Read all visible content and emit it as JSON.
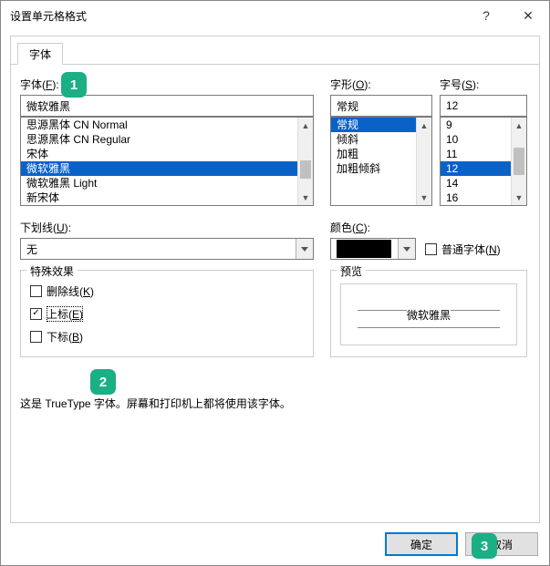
{
  "window": {
    "title": "设置单元格格式"
  },
  "tabs": {
    "font": "字体"
  },
  "labels": {
    "font": "字体(",
    "font_key": "F",
    "font_suffix": "):",
    "style": "字形(",
    "style_key": "O",
    "style_suffix": "):",
    "size": "字号(",
    "size_key": "S",
    "size_suffix": "):",
    "underline": "下划线(",
    "underline_key": "U",
    "underline_suffix": "):",
    "color": "颜色(",
    "color_key": "C",
    "color_suffix": "):",
    "effects": "特殊效果",
    "preview": "预览",
    "strike": "删除线(",
    "strike_key": "K",
    "strike_suffix": ")",
    "super": "上标(",
    "super_key": "E",
    "super_suffix": ")",
    "sub": "下标(",
    "sub_key": "B",
    "sub_suffix": ")",
    "normalfont": "普通字体(",
    "normalfont_key": "N",
    "normalfont_suffix": ")"
  },
  "font": {
    "value": "微软雅黑",
    "items": [
      "思源黑体 CN Normal",
      "思源黑体 CN Regular",
      "宋体",
      "微软雅黑",
      "微软雅黑 Light",
      "新宋体"
    ],
    "selected_index": 3
  },
  "style": {
    "value": "常规",
    "items": [
      "常规",
      "倾斜",
      "加粗",
      "加粗倾斜"
    ],
    "selected_index": 0
  },
  "size": {
    "value": "12",
    "items": [
      "9",
      "10",
      "11",
      "12",
      "14",
      "16"
    ],
    "selected_index": 3
  },
  "underline": {
    "value": "无"
  },
  "color": {
    "value_hex": "#000000"
  },
  "effects": {
    "strike": false,
    "super": true,
    "sub": false
  },
  "normalfont": false,
  "preview_text": "微软雅黑",
  "note": "这是 TrueType 字体。屏幕和打印机上都将使用该字体。",
  "buttons": {
    "ok": "确定",
    "cancel": "取消"
  },
  "badges": {
    "b1": "1",
    "b2": "2",
    "b3": "3"
  }
}
